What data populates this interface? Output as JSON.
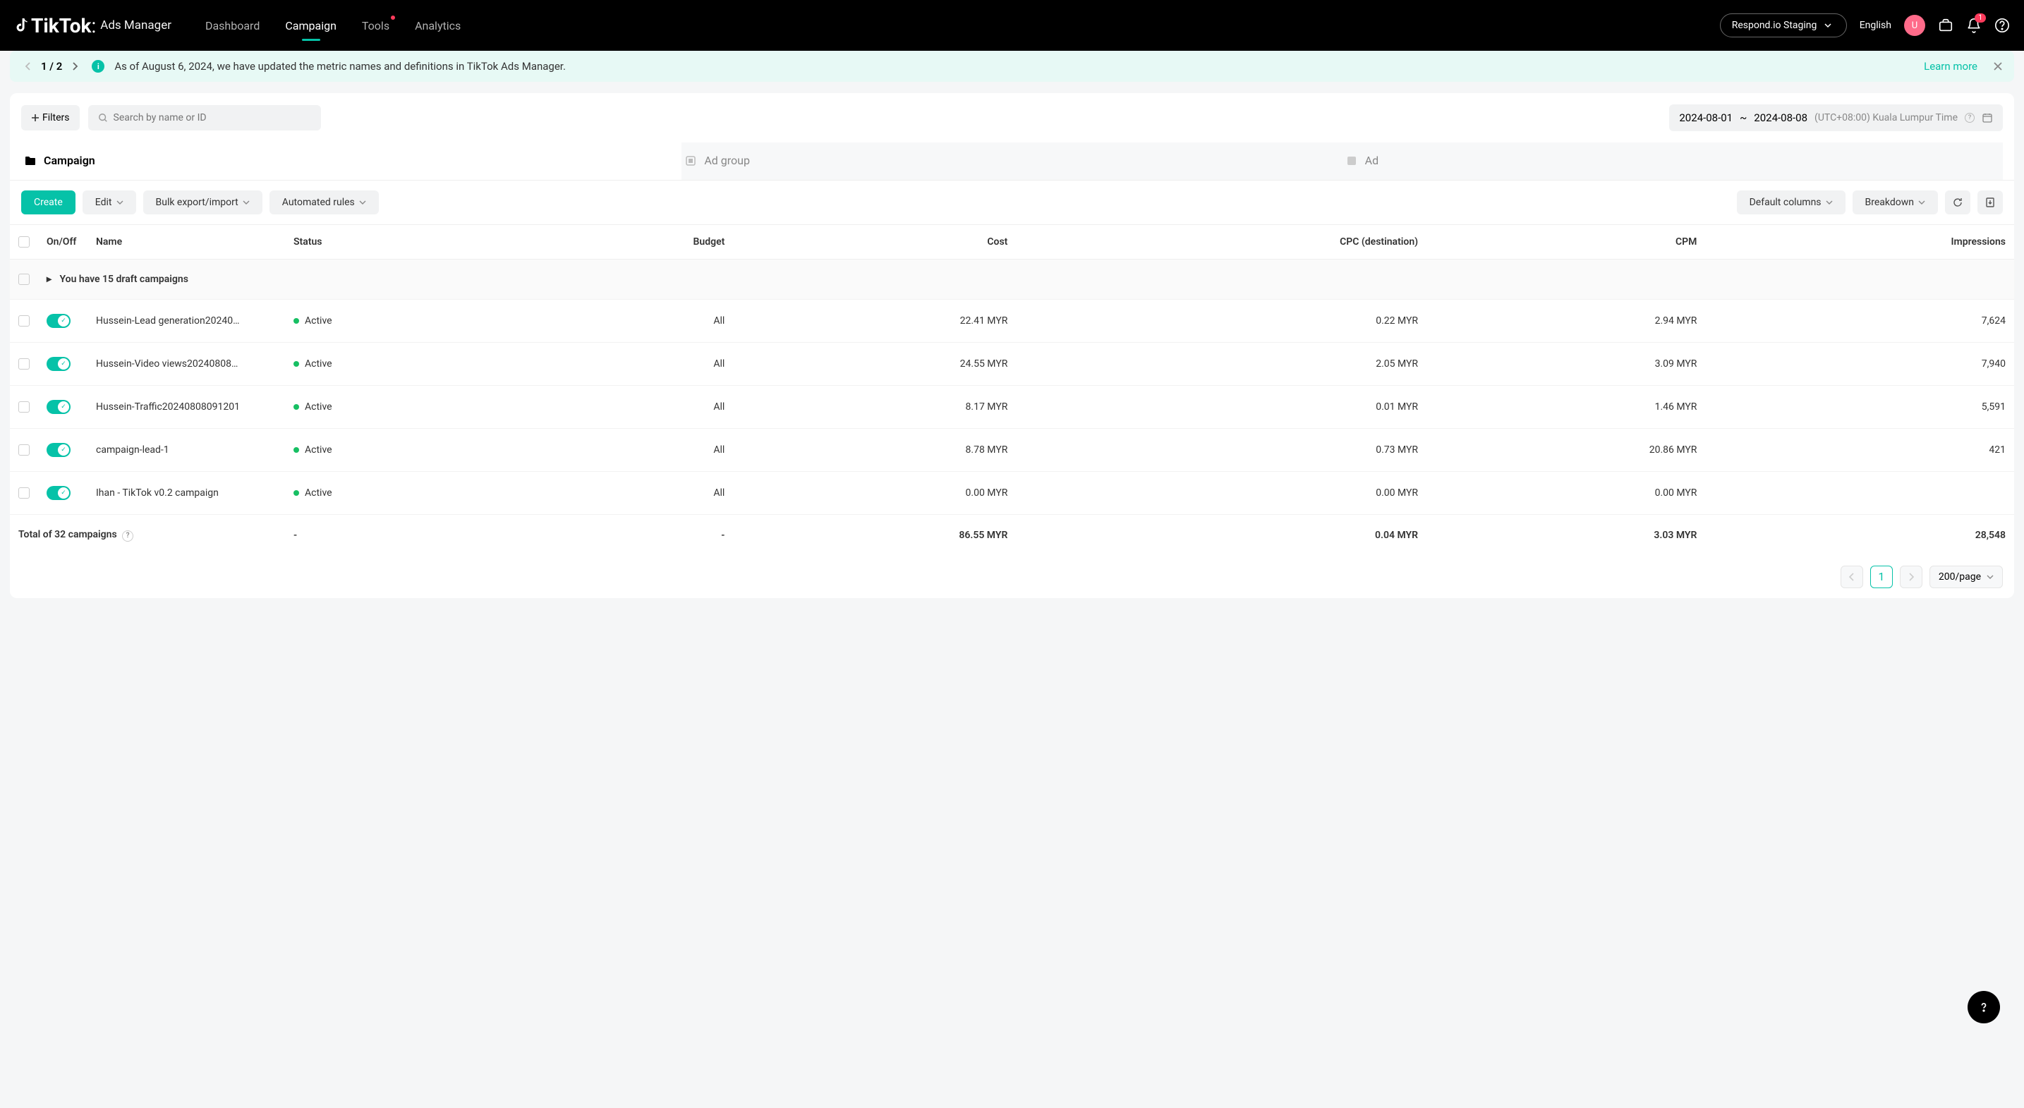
{
  "header": {
    "brand": "TikTok",
    "brand_sub": "Ads Manager",
    "nav": [
      "Dashboard",
      "Campaign",
      "Tools",
      "Analytics"
    ],
    "account": "Respond.io Staging",
    "language": "English",
    "avatar_initial": "U",
    "notif_count": "1"
  },
  "banner": {
    "position": "1 / 2",
    "message": "As of August 6, 2024, we have updated the metric names and definitions in TikTok Ads Manager.",
    "learn_more": "Learn more"
  },
  "filters": {
    "button_label": "Filters",
    "search_placeholder": "Search by name or ID",
    "date_start": "2024-08-01",
    "date_sep": "~",
    "date_end": "2024-08-08",
    "timezone": "(UTC+08:00) Kuala Lumpur Time"
  },
  "tabs": {
    "campaign": "Campaign",
    "adgroup": "Ad group",
    "ad": "Ad"
  },
  "toolbar": {
    "create": "Create",
    "edit": "Edit",
    "bulk": "Bulk export/import",
    "automated": "Automated rules",
    "columns": "Default columns",
    "breakdown": "Breakdown"
  },
  "columns": {
    "onoff": "On/Off",
    "name": "Name",
    "status": "Status",
    "budget": "Budget",
    "cost": "Cost",
    "cpc": "CPC (destination)",
    "cpm": "CPM",
    "impressions": "Impressions"
  },
  "draft_message": "You have 15 draft campaigns",
  "rows": [
    {
      "name": "Hussein-Lead generation20240…",
      "status": "Active",
      "budget": "All",
      "cost": "22.41 MYR",
      "cpc": "0.22 MYR",
      "cpm": "2.94 MYR",
      "impressions": "7,624"
    },
    {
      "name": "Hussein-Video views20240808…",
      "status": "Active",
      "budget": "All",
      "cost": "24.55 MYR",
      "cpc": "2.05 MYR",
      "cpm": "3.09 MYR",
      "impressions": "7,940"
    },
    {
      "name": "Hussein-Traffic20240808091201",
      "status": "Active",
      "budget": "All",
      "cost": "8.17 MYR",
      "cpc": "0.01 MYR",
      "cpm": "1.46 MYR",
      "impressions": "5,591"
    },
    {
      "name": "campaign-lead-1",
      "status": "Active",
      "budget": "All",
      "cost": "8.78 MYR",
      "cpc": "0.73 MYR",
      "cpm": "20.86 MYR",
      "impressions": "421"
    },
    {
      "name": "Ihan - TikTok v0.2 campaign",
      "status": "Active",
      "budget": "All",
      "cost": "0.00 MYR",
      "cpc": "0.00 MYR",
      "cpm": "0.00 MYR",
      "impressions": ""
    }
  ],
  "totals": {
    "label": "Total of 32 campaigns",
    "status": "-",
    "budget": "-",
    "cost": "86.55 MYR",
    "cpc": "0.04 MYR",
    "cpm": "3.03 MYR",
    "impressions": "28,548"
  },
  "pagination": {
    "current": "1",
    "page_size": "200/page"
  }
}
